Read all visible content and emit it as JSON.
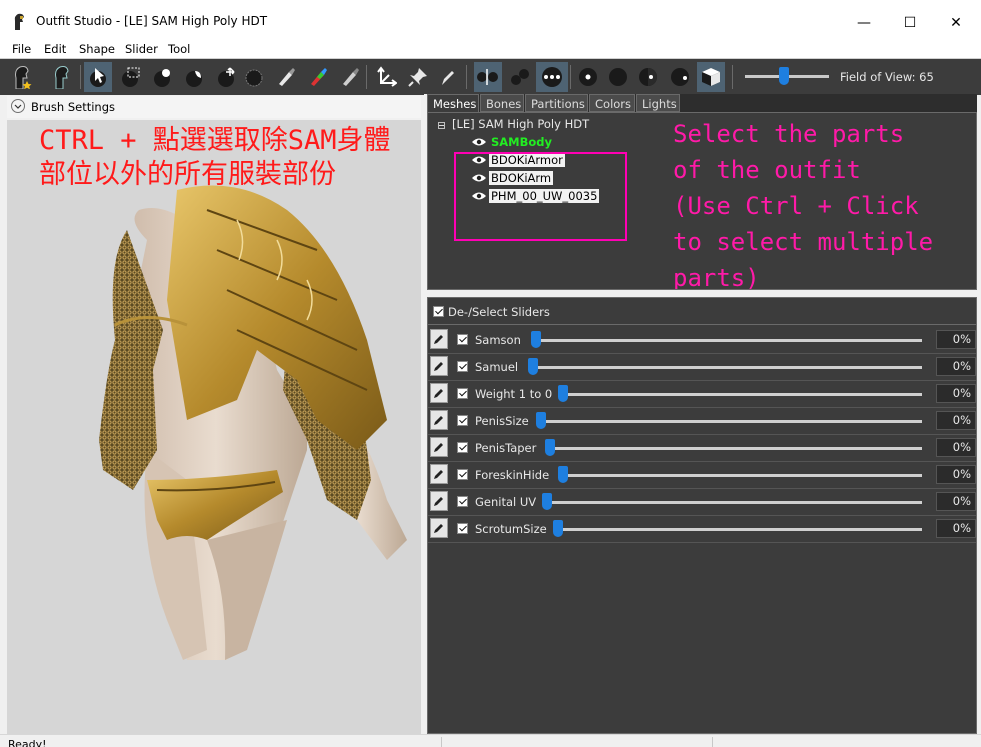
{
  "window": {
    "title": "Outfit Studio - [LE] SAM High Poly HDT",
    "minimize_glyph": "—",
    "maximize_glyph": "☐",
    "close_glyph": "✕"
  },
  "menu": [
    "File",
    "Edit",
    "Shape",
    "Slider",
    "Tool"
  ],
  "toolbar": {
    "fov_label": "Field of View: 65",
    "fov_value": 65
  },
  "brush_settings": {
    "label": "Brush Settings"
  },
  "viewport": {
    "annotation": "CTRL + 點選選取除SAM身體\n部位以外的所有服裝部份"
  },
  "tabs": [
    {
      "label": "Meshes",
      "active": true
    },
    {
      "label": "Bones",
      "active": false
    },
    {
      "label": "Partitions",
      "active": false
    },
    {
      "label": "Colors",
      "active": false
    },
    {
      "label": "Lights",
      "active": false
    }
  ],
  "mesh_tree": {
    "root": "[LE] SAM High Poly HDT",
    "items": [
      {
        "label": "SAMBody",
        "state": "body"
      },
      {
        "label": "BDOKiArmor",
        "state": "selected"
      },
      {
        "label": "BDOKiArm",
        "state": "selected"
      },
      {
        "label": "PHM_00_UW_0035",
        "state": "selected"
      }
    ],
    "annotation": "Select the parts\nof the outfit\n(Use Ctrl + Click\nto select multiple\nparts)"
  },
  "sliders": {
    "header": "De-/Select Sliders",
    "rows": [
      {
        "name": "Samson",
        "value": "0%"
      },
      {
        "name": "Samuel",
        "value": "0%"
      },
      {
        "name": "Weight 1 to 0",
        "value": "0%"
      },
      {
        "name": "PenisSize",
        "value": "0%"
      },
      {
        "name": "PenisTaper",
        "value": "0%"
      },
      {
        "name": "ForeskinHide",
        "value": "0%"
      },
      {
        "name": "Genital UV",
        "value": "0%"
      },
      {
        "name": "ScrotumSize",
        "value": "0%"
      }
    ]
  },
  "status": {
    "text": "Ready!"
  },
  "colors": {
    "accent": "#1e7fe0",
    "body_label": "#22ee22",
    "annotation_pink": "#ff1aa8",
    "annotation_red": "#ff1a1a"
  }
}
